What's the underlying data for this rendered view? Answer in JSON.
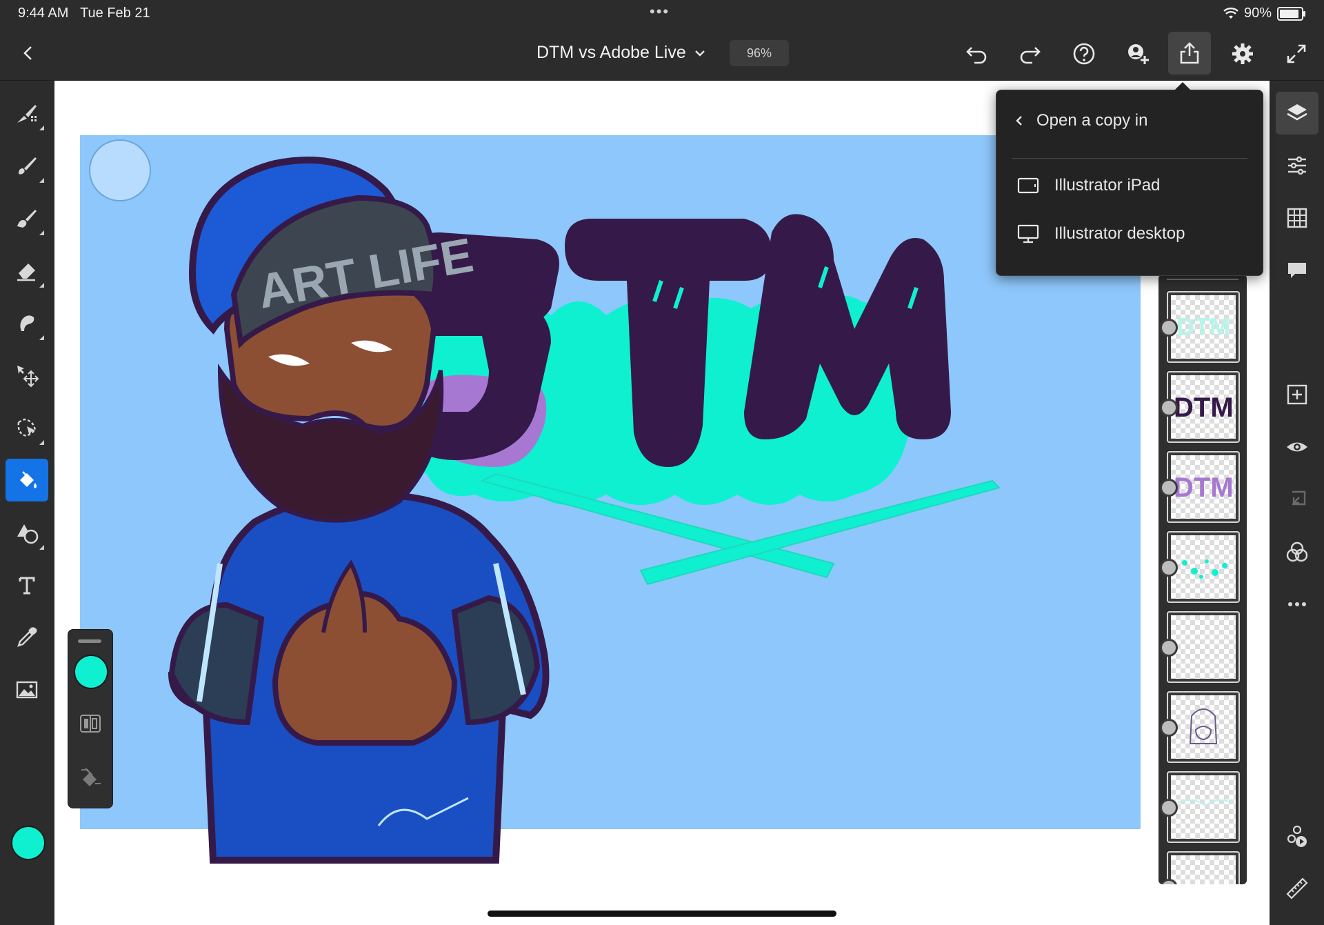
{
  "status_bar": {
    "time": "9:44 AM",
    "date": "Tue Feb 21",
    "multitask": "•••",
    "battery": "90%"
  },
  "header": {
    "title": "DTM vs Adobe Live",
    "zoom": "96%",
    "icons": [
      "back-icon",
      "undo-icon",
      "redo-icon",
      "help-icon",
      "invite-icon",
      "share-icon",
      "settings-icon",
      "fullscreen-icon"
    ]
  },
  "share_menu": {
    "heading": "Open a copy in",
    "items": [
      {
        "label": "Illustrator iPad",
        "icon": "tablet-icon"
      },
      {
        "label": "Illustrator desktop",
        "icon": "desktop-icon"
      }
    ]
  },
  "left_tools": [
    "brush-set-icon",
    "paint-brush-icon",
    "smudge-brush-icon",
    "eraser-icon",
    "lasso-icon",
    "transform-icon",
    "selection-icon",
    "fill-icon",
    "shapes-icon",
    "text-icon",
    "eyedropper-icon",
    "image-icon"
  ],
  "active_tool": "fill-icon",
  "current_color": "#0ff0d0",
  "right_tools": [
    "layers-icon",
    "layer-properties-icon",
    "grid-icon",
    "comments-icon",
    "add-layer-icon",
    "visibility-icon",
    "merge-icon",
    "blend-icon",
    "more-icon",
    "timelapse-icon",
    "ruler-icon"
  ],
  "colors": {
    "accent": "#1473e6",
    "artboard": "#8ec7fb",
    "teal": "#0ff0d0",
    "purple": "#351a49"
  }
}
